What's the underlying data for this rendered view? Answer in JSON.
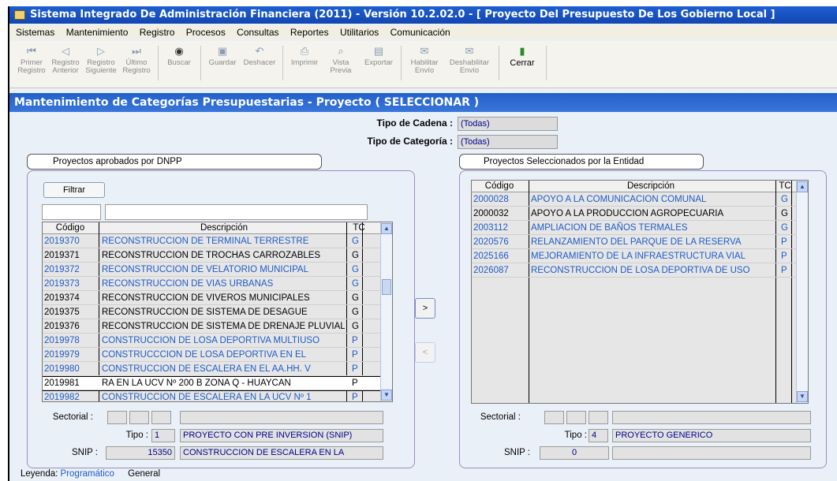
{
  "window": {
    "title": "Sistema Integrado De Administración Financiera (2011) - Versión 10.2.02.0 - [ Proyecto Del Presupuesto De Los Gobierno Local ]"
  },
  "menu": [
    "Sistemas",
    "Mantenimiento",
    "Registro",
    "Procesos",
    "Consultas",
    "Reportes",
    "Utilitarios",
    "Comunicación"
  ],
  "toolbar": {
    "primer": [
      "Primer",
      "Registro"
    ],
    "anterior": [
      "Registro",
      "Anterior"
    ],
    "siguiente": [
      "Registro",
      "Siguiente"
    ],
    "ultimo": [
      "Último",
      "Registro"
    ],
    "buscar": "Buscar",
    "guardar": "Guardar",
    "deshacer": "Deshacer",
    "imprimir": "Imprimir",
    "vista": [
      "Vista",
      "Previa"
    ],
    "exportar": "Exportar",
    "habilitar": [
      "Habilitar",
      "Envío"
    ],
    "deshabilitar": [
      "Deshabilitar",
      "Envío"
    ],
    "cerrar": "Cerrar"
  },
  "form": {
    "title": "Mantenimiento de Categorías Presupuestarias - Proyecto ( SELECCIONAR )",
    "tipo_cadena_label": "Tipo de Cadena :",
    "tipo_cadena_value": "(Todas)",
    "tipo_categoria_label": "Tipo de Categoría :",
    "tipo_categoria_value": "(Todas)"
  },
  "left": {
    "heading": "Proyectos aprobados por DNPP",
    "filter_button": "Filtrar",
    "filter_code": "",
    "filter_desc": "",
    "columns": [
      "Código",
      "Descripción",
      "TC"
    ],
    "rows": [
      {
        "code": "2019370",
        "desc": "RECONSTRUCCION DE TERMINAL TERRESTRE",
        "tc": "G",
        "prog": true
      },
      {
        "code": "2019371",
        "desc": "RECONSTRUCCION DE TROCHAS CARROZABLES",
        "tc": "G",
        "prog": false
      },
      {
        "code": "2019372",
        "desc": "RECONSTRUCCION DE VELATORIO MUNICIPAL",
        "tc": "G",
        "prog": true
      },
      {
        "code": "2019373",
        "desc": "RECONSTRUCCION DE VIAS URBANAS",
        "tc": "G",
        "prog": true
      },
      {
        "code": "2019374",
        "desc": "RECONSTRUCCION DE VIVEROS MUNICIPALES",
        "tc": "G",
        "prog": false
      },
      {
        "code": "2019375",
        "desc": "RECONSTRUCCION DE SISTEMA DE DESAGUE",
        "tc": "G",
        "prog": false
      },
      {
        "code": "2019376",
        "desc": "RECONSTRUCCION DE SISTEMA DE DRENAJE PLUVIAL",
        "tc": "G",
        "prog": false
      },
      {
        "code": "2019978",
        "desc": "CONSTRUCCION DE LOSA DEPORTIVA MULTIUSO",
        "tc": "P",
        "prog": true
      },
      {
        "code": "2019979",
        "desc": "CONSTRUCCCION DE LOSA DEPORTIVA EN EL",
        "tc": "P",
        "prog": true
      },
      {
        "code": "2019980",
        "desc": "CONSTRUCCION DE ESCALERA EN EL AA.HH. V",
        "tc": "P",
        "prog": true
      },
      {
        "code": "2019981",
        "desc": "RA EN LA UCV Nº 200 B ZONA Q - HUAYCAN",
        "tc": "P",
        "prog": false,
        "sel": true
      },
      {
        "code": "2019982",
        "desc": "CONSTRUCCION DE ESCALERA EN LA UCV Nº 1",
        "tc": "P",
        "prog": true
      }
    ],
    "sectorial_label": "Sectorial :",
    "tipo_label": "Tipo :",
    "tipo_code": "1",
    "tipo_desc": "PROYECTO CON PRE INVERSION (SNIP)",
    "snip_label": "SNIP :",
    "snip_code": "15350",
    "snip_desc": "CONSTRUCCION DE ESCALERA EN LA"
  },
  "right": {
    "heading": "Proyectos Seleccionados por la Entidad",
    "columns": [
      "Código",
      "Descripción",
      "TC"
    ],
    "rows": [
      {
        "code": "2000028",
        "desc": "APOYO A LA COMUNICACION COMUNAL",
        "tc": "G",
        "prog": true
      },
      {
        "code": "2000032",
        "desc": "APOYO A LA PRODUCCION AGROPECUARIA",
        "tc": "G",
        "prog": false
      },
      {
        "code": "2003112",
        "desc": "AMPLIACION DE BAÑOS TERMALES",
        "tc": "G",
        "prog": true
      },
      {
        "code": "2020576",
        "desc": "RELANZAMIENTO DEL PARQUE DE LA RESERVA",
        "tc": "P",
        "prog": true
      },
      {
        "code": "2025166",
        "desc": "MEJORAMIENTO DE LA INFRAESTRUCTURA VIAL",
        "tc": "P",
        "prog": true
      },
      {
        "code": "2026087",
        "desc": "RECONSTRUCCION DE LOSA DEPORTIVA DE USO",
        "tc": "P",
        "prog": true
      }
    ],
    "sectorial_label": "Sectorial :",
    "tipo_label": "Tipo :",
    "tipo_code": "4",
    "tipo_desc": "PROYECTO GENERICO",
    "snip_label": "SNIP :",
    "snip_code": "0"
  },
  "move": {
    "add": ">",
    "remove": "<"
  },
  "legend": {
    "label": "Leyenda:",
    "programatico": "Programático",
    "general": "General"
  },
  "colors": {
    "programatico": "#1f5bc6",
    "general": "#000000",
    "title_bar": "#1d5fd1"
  }
}
